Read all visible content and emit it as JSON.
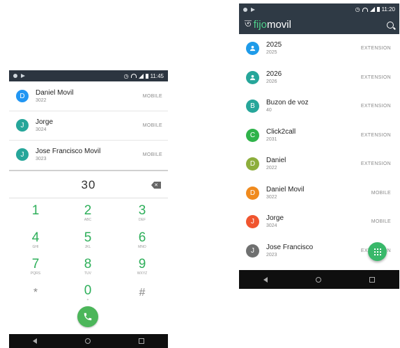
{
  "left_phone": {
    "status": {
      "time": "11:45"
    },
    "contacts": [
      {
        "initial": "D",
        "name": "Daniel Movil",
        "number": "3022",
        "type": "MOBILE",
        "color": "#2196f3"
      },
      {
        "initial": "J",
        "name": "Jorge",
        "number": "3024",
        "type": "MOBILE",
        "color": "#26a69a"
      },
      {
        "initial": "J",
        "name": "Jose Francisco Movil",
        "number": "3023",
        "type": "MOBILE",
        "color": "#26a69a"
      }
    ],
    "dialpad": {
      "value": "30",
      "keys": [
        {
          "digit": "1",
          "letters": ""
        },
        {
          "digit": "2",
          "letters": "ABC"
        },
        {
          "digit": "3",
          "letters": "DEF"
        },
        {
          "digit": "4",
          "letters": "GHI"
        },
        {
          "digit": "5",
          "letters": "JKL"
        },
        {
          "digit": "6",
          "letters": "MNO"
        },
        {
          "digit": "7",
          "letters": "PQRS"
        },
        {
          "digit": "8",
          "letters": "TUV"
        },
        {
          "digit": "9",
          "letters": "WXYZ"
        },
        {
          "digit": "*",
          "letters": ""
        },
        {
          "digit": "0",
          "letters": "+"
        },
        {
          "digit": "#",
          "letters": ""
        }
      ]
    }
  },
  "right_phone": {
    "status": {
      "time": "11:20"
    },
    "app": {
      "brand_fi": "fijo",
      "brand_movil": "movil"
    },
    "contacts": [
      {
        "initial": "",
        "name": "2025",
        "number": "2025",
        "type": "EXTENSION",
        "color": "#1e9be9",
        "icon": "person-icon"
      },
      {
        "initial": "",
        "name": "2026",
        "number": "2026",
        "type": "EXTENSION",
        "color": "#26a69a",
        "icon": "person-icon"
      },
      {
        "initial": "B",
        "name": "Buzon de voz",
        "number": "40",
        "type": "EXTENSION",
        "color": "#26a69a"
      },
      {
        "initial": "C",
        "name": "Click2call",
        "number": "2031",
        "type": "EXTENSION",
        "color": "#2fb34a"
      },
      {
        "initial": "D",
        "name": "Daniel",
        "number": "2022",
        "type": "EXTENSION",
        "color": "#8dae3c"
      },
      {
        "initial": "D",
        "name": "Daniel Movil",
        "number": "3022",
        "type": "MOBILE",
        "color": "#f08a1d"
      },
      {
        "initial": "J",
        "name": "Jorge",
        "number": "3024",
        "type": "MOBILE",
        "color": "#f0552f"
      },
      {
        "initial": "J",
        "name": "Jose Francisco",
        "number": "2023",
        "type": "EXTENSION",
        "color": "#6f7070"
      }
    ]
  }
}
